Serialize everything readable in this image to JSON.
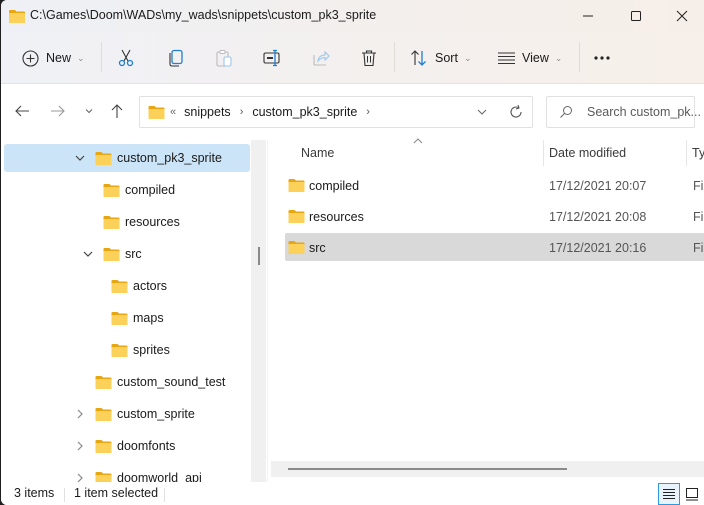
{
  "window": {
    "title": "C:\\Games\\Doom\\WADs\\my_wads\\snippets\\custom_pk3_sprite",
    "controls": {
      "minimize": "minimize",
      "maximize": "maximize",
      "close": "close"
    }
  },
  "commandbar": {
    "new_label": "New",
    "sort_label": "Sort",
    "view_label": "View",
    "buttons": [
      "cut",
      "copy",
      "paste",
      "rename",
      "share",
      "delete"
    ],
    "more_label": "..."
  },
  "addressbar": {
    "overflow": "«",
    "crumbs": [
      "snippets",
      "custom_pk3_sprite"
    ],
    "search_placeholder": "Search custom_pk..."
  },
  "navtree": {
    "items": [
      {
        "label": "custom_pk3_sprite",
        "expanded": true,
        "selected": true
      },
      {
        "label": "compiled"
      },
      {
        "label": "resources"
      },
      {
        "label": "src",
        "expanded": true
      },
      {
        "label": "actors"
      },
      {
        "label": "maps"
      },
      {
        "label": "sprites"
      },
      {
        "label": "custom_sound_test"
      },
      {
        "label": "custom_sprite",
        "collapsed": true
      },
      {
        "label": "doomfonts",
        "collapsed": true
      },
      {
        "label": "doomworld_api",
        "collapsed": true
      }
    ]
  },
  "filelist": {
    "columns": {
      "name": "Name",
      "date": "Date modified",
      "type": "Ty"
    },
    "rows": [
      {
        "name": "compiled",
        "date": "17/12/2021 20:07",
        "type": "Fil",
        "selected": false
      },
      {
        "name": "resources",
        "date": "17/12/2021 20:08",
        "type": "Fil",
        "selected": false
      },
      {
        "name": "src",
        "date": "17/12/2021 20:16",
        "type": "Fil",
        "selected": true
      }
    ]
  },
  "statusbar": {
    "count": "3 items",
    "selection": "1 item selected"
  },
  "colors": {
    "selection_nav": "#cce4f7",
    "selection_file": "#d9d9d9",
    "folder": "#f8c843",
    "accent": "#2b9ae0"
  }
}
